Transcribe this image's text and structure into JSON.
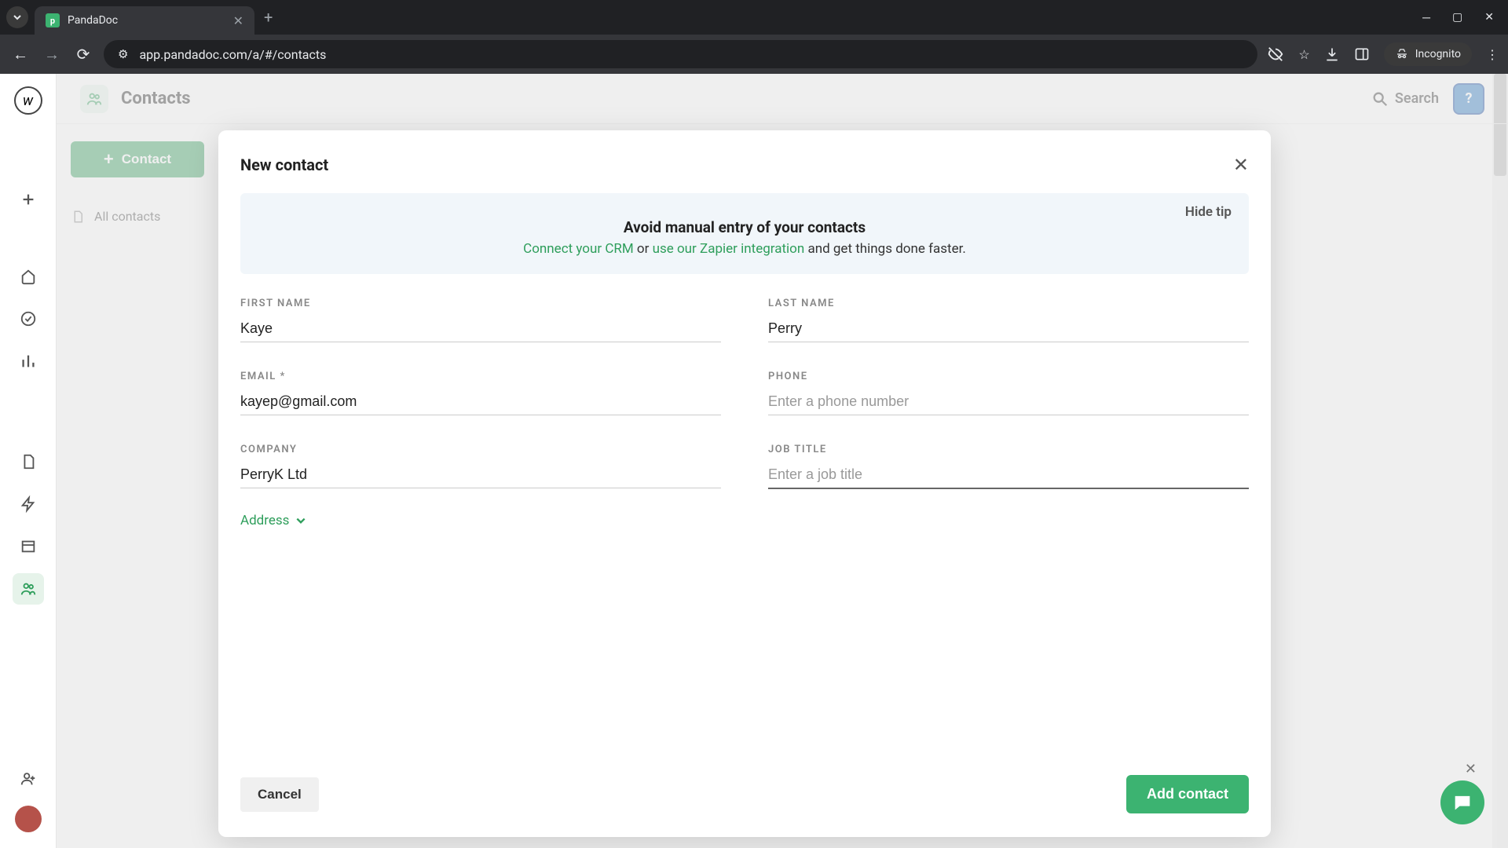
{
  "browser": {
    "tab_title": "PandaDoc",
    "url": "app.pandadoc.com/a/#/contacts",
    "incognito_label": "Incognito"
  },
  "header": {
    "title": "Contacts",
    "search": "Search"
  },
  "sidebar": {
    "add_contact": "Contact",
    "all_contacts": "All contacts"
  },
  "modal": {
    "title": "New contact",
    "tip": {
      "hide": "Hide tip",
      "heading": "Avoid manual entry of your contacts",
      "link1": "Connect your CRM",
      "mid1": " or ",
      "link2": "use our Zapier integration",
      "mid2": " and get things done faster."
    },
    "fields": {
      "first_name": {
        "label": "FIRST NAME",
        "value": "Kaye"
      },
      "last_name": {
        "label": "LAST NAME",
        "value": "Perry"
      },
      "email": {
        "label": "EMAIL *",
        "value": "kayep@gmail.com"
      },
      "phone": {
        "label": "PHONE",
        "value": "",
        "placeholder": "Enter a phone number"
      },
      "company": {
        "label": "COMPANY",
        "value": "PerryK Ltd"
      },
      "job_title": {
        "label": "JOB TITLE",
        "value": "",
        "placeholder": "Enter a job title"
      }
    },
    "address_toggle": "Address",
    "cancel": "Cancel",
    "submit": "Add contact"
  }
}
